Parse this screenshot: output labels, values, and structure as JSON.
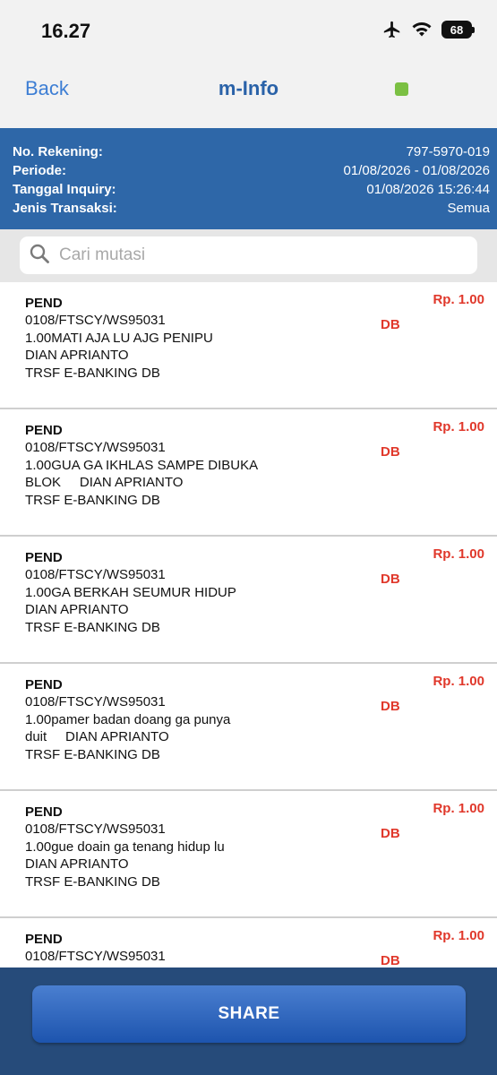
{
  "status_bar": {
    "time": "16.27",
    "battery": "68"
  },
  "nav": {
    "back_label": "Back",
    "title": "m-Info",
    "indicator_color": "#7bc043"
  },
  "info": {
    "rows": [
      {
        "label": "No. Rekening:",
        "value": "797-5970-019"
      },
      {
        "label": "Periode:",
        "value": "01/08/2026 - 01/08/2026"
      },
      {
        "label": "Tanggal Inquiry:",
        "value": "01/08/2026 15:26:44"
      },
      {
        "label": "Jenis Transaksi:",
        "value": "Semua"
      }
    ]
  },
  "search": {
    "placeholder": "Cari mutasi",
    "value": ""
  },
  "transactions": [
    {
      "status": "PEND",
      "lines": [
        "0108/FTSCY/WS95031",
        "1.00MATI AJA LU AJG PENIPU",
        "DIAN APRIANTO",
        "TRSF E-BANKING DB"
      ],
      "type": "DB",
      "amount": "Rp. 1.00"
    },
    {
      "status": "PEND",
      "lines": [
        "0108/FTSCY/WS95031",
        "1.00GUA GA IKHLAS SAMPE DIBUKA",
        "BLOK     DIAN APRIANTO",
        "TRSF E-BANKING DB"
      ],
      "type": "DB",
      "amount": "Rp. 1.00"
    },
    {
      "status": "PEND",
      "lines": [
        "0108/FTSCY/WS95031",
        "1.00GA BERKAH SEUMUR HIDUP",
        "DIAN APRIANTO",
        "TRSF E-BANKING DB"
      ],
      "type": "DB",
      "amount": "Rp. 1.00"
    },
    {
      "status": "PEND",
      "lines": [
        "0108/FTSCY/WS95031",
        "1.00pamer badan doang ga punya",
        "duit     DIAN APRIANTO",
        "TRSF E-BANKING DB"
      ],
      "type": "DB",
      "amount": "Rp. 1.00"
    },
    {
      "status": "PEND",
      "lines": [
        "0108/FTSCY/WS95031",
        "1.00gue doain ga tenang hidup lu",
        "DIAN APRIANTO",
        "TRSF E-BANKING DB"
      ],
      "type": "DB",
      "amount": "Rp. 1.00"
    },
    {
      "status": "PEND",
      "lines": [
        "0108/FTSCY/WS95031"
      ],
      "type": "DB",
      "amount": "Rp. 1.00"
    }
  ],
  "share_button": {
    "label": "SHARE"
  },
  "colors": {
    "header_blue": "#2e67a8",
    "accent_red": "#e0382b",
    "link_blue": "#3d7ed4",
    "bottom_bar": "#264b7a"
  },
  "icons": {
    "airplane": "airplane-icon",
    "wifi": "wifi-icon",
    "battery": "battery-icon",
    "search": "search-icon"
  }
}
